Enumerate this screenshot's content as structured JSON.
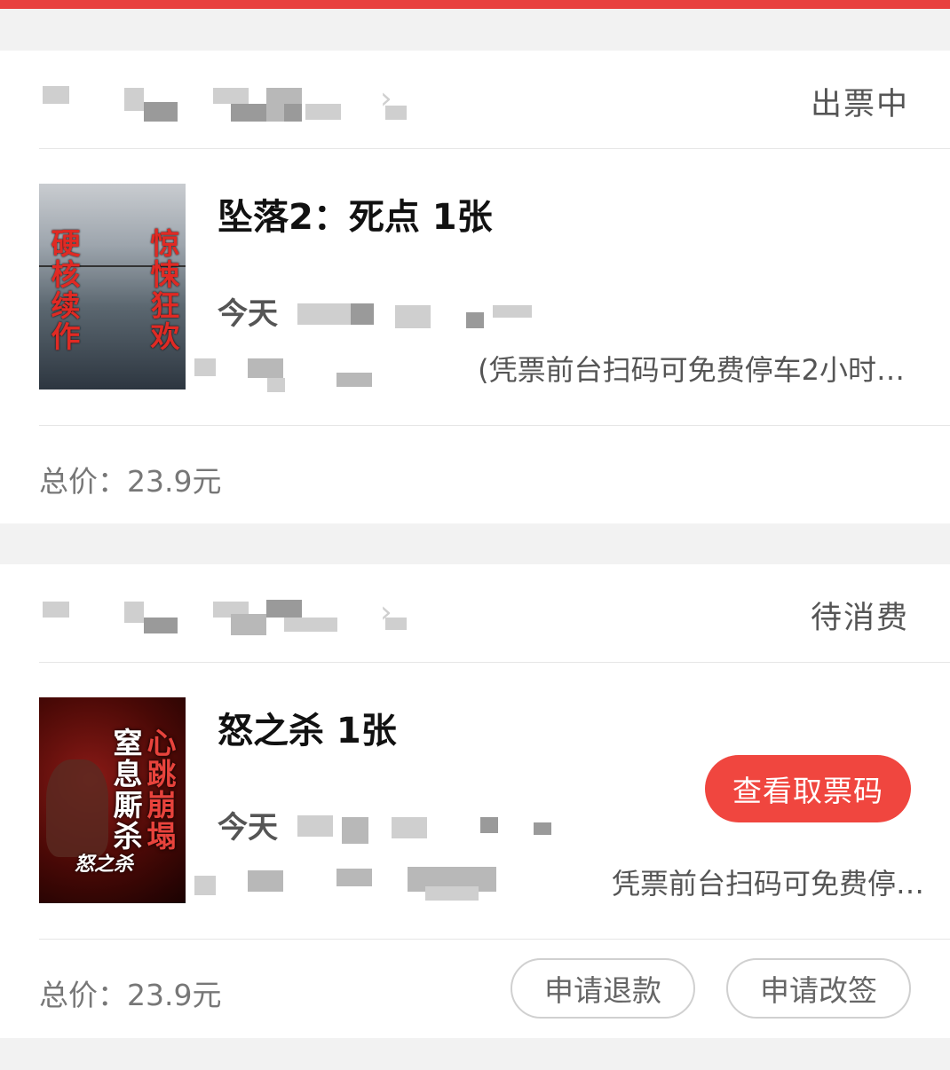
{
  "orders": [
    {
      "status": "出票中",
      "movie_title": "坠落2：死点 1张",
      "showtime_prefix": "今天",
      "hall_note": "(凭票前台扫码可免费停车2小时…",
      "total_label": "总价：",
      "total_value": "23.9元",
      "poster": {
        "left_text": "硬核续作",
        "right_text": "惊悚狂欢"
      }
    },
    {
      "status": "待消费",
      "movie_title": "怒之杀 1张",
      "showtime_prefix": "今天",
      "hall_note": "凭票前台扫码可免费停…",
      "total_label": "总价：",
      "total_value": "23.9元",
      "poster": {
        "left_text": "窒息厮杀",
        "right_text": "心跳崩塌",
        "logo": "怒之杀"
      },
      "ticket_button": "查看取票码",
      "refund_button": "申请退款",
      "change_button": "申请改签"
    }
  ],
  "colors": {
    "accent": "#f0463f",
    "topbar": "#e8413f"
  }
}
